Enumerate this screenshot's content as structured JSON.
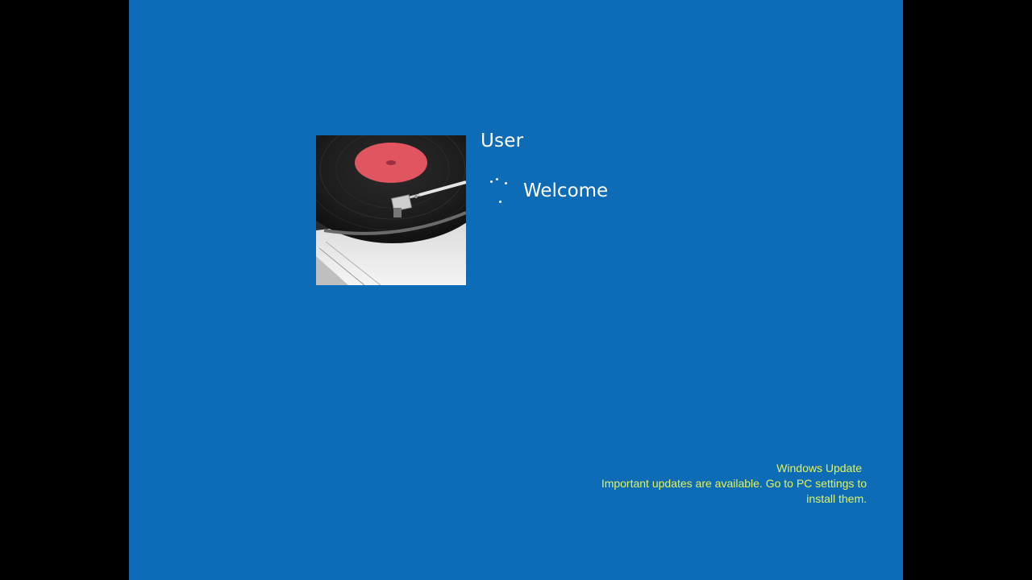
{
  "screen": {
    "background_color": "#0d6cb5",
    "letterbox_color": "#000000"
  },
  "user": {
    "name": "User",
    "avatar": "vinyl-turntable-picture"
  },
  "status": {
    "text": "Welcome",
    "icon": "loading-spinner-icon"
  },
  "notification": {
    "title": "Windows Update",
    "message": "Important updates are available. Go to PC settings to install them.",
    "color": "#e3f35a"
  }
}
